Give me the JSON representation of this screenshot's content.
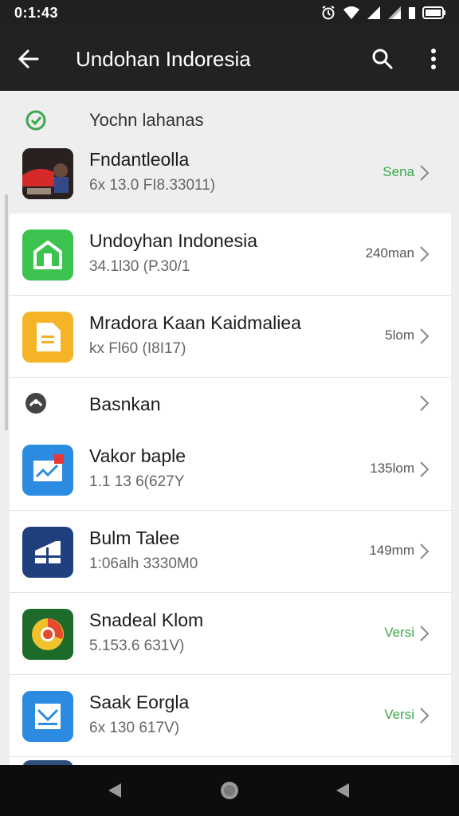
{
  "status_bar": {
    "time": "0:1:43"
  },
  "app_bar": {
    "title": "Undohan Indoresia"
  },
  "colors": {
    "app_bar": "#222222",
    "status_green": "#3aa84a",
    "icon_green": "#3cc24f",
    "icon_yellow": "#f5b428",
    "icon_blue": "#2b8be0",
    "icon_navy": "#1f3f7f",
    "icon_dark_green": "#1d6b2b"
  },
  "sections": [
    {
      "label": "Yochn lahanas",
      "icon": "check-circle-icon"
    },
    {
      "label": "Basnkan",
      "icon": "badge-icon"
    }
  ],
  "apps": [
    {
      "name": "Fndantleolla",
      "detail": "6x 13.0 FI8.33011)",
      "meta": "Sena",
      "icon": "photo-app-icon"
    },
    {
      "name": "Undoyhan Indonesia",
      "detail": "34.1l30 (P.30/1",
      "meta": "240man",
      "icon": "green-home-icon"
    },
    {
      "name": "Mradora Kaan Kaidmaliea",
      "detail": "kx Fl60 (I8I17)",
      "meta": "5lom",
      "icon": "document-icon"
    },
    {
      "name": "Vakor baple",
      "detail": "1.1 13 6(627Y",
      "meta": "135lom",
      "icon": "chart-app-icon"
    },
    {
      "name": "Bulm Talee",
      "detail": "1:06alh 3330M0",
      "meta": "149mm",
      "icon": "grid-app-icon"
    },
    {
      "name": "Snadeal Klom",
      "detail": "5.153.6 631V)",
      "meta": "Versi",
      "icon": "chrome-like-icon"
    },
    {
      "name": "Saak Eorgla",
      "detail": "6x 130 617V)",
      "meta": "Versi",
      "icon": "mail-app-icon"
    }
  ]
}
